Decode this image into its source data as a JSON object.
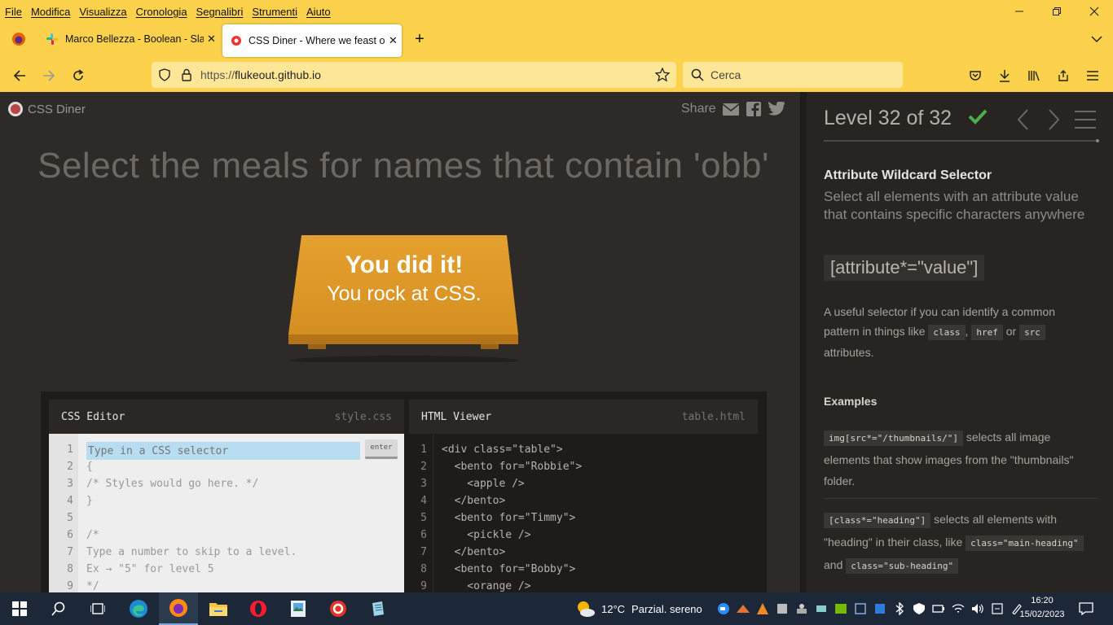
{
  "menu": [
    "File",
    "Modifica",
    "Visualizza",
    "Cronologia",
    "Segnalibri",
    "Strumenti",
    "Aiuto"
  ],
  "tabs": [
    {
      "label": "Marco Bellezza - Boolean - Slack"
    },
    {
      "label": "CSS Diner - Where we feast on CSS"
    }
  ],
  "url": {
    "prefix": "https://",
    "host": "flukeout.github.io"
  },
  "search": {
    "placeholder": "Cerca"
  },
  "site": {
    "brand": "CSS Diner",
    "share_label": "Share"
  },
  "instruction": "Select the meals for names that contain 'obb'",
  "table_message": {
    "line1": "You did it!",
    "line2": "You rock at CSS."
  },
  "css_editor": {
    "title": "CSS Editor",
    "file": "style.css",
    "placeholder": "Type in a CSS selector",
    "enter_label": "enter",
    "lines": [
      "{",
      "/* Styles would go here. */",
      "}",
      "",
      "/*",
      "Type a number to skip to a level.",
      "Ex → \"5\" for level 5",
      "*/"
    ],
    "line_numbers": [
      "1",
      "2",
      "3",
      "4",
      "5",
      "6",
      "7",
      "8",
      "9"
    ]
  },
  "html_viewer": {
    "title": "HTML Viewer",
    "file": "table.html",
    "lines": [
      "<div class=\"table\">",
      "  <bento for=\"Robbie\">",
      "    <apple />",
      "  </bento>",
      "  <bento for=\"Timmy\">",
      "    <pickle />",
      "  </bento>",
      "  <bento for=\"Bobby\">",
      "    <orange />"
    ],
    "line_numbers": [
      "1",
      "2",
      "3",
      "4",
      "5",
      "6",
      "7",
      "8",
      "9"
    ]
  },
  "level": {
    "label": "Level 32 of 32",
    "accent": "#4cae4c"
  },
  "selector": {
    "name": "Attribute Wildcard Selector",
    "title": "Select all elements with an attribute value that contains specific characters anywhere",
    "syntax": "[attribute*=\"value\"]",
    "hint_text1": "A useful selector if you can identify a common pattern in things like",
    "hint_code1": "class",
    "hint_sep": ",",
    "hint_code2": "href",
    "hint_or": "or",
    "hint_code3": "src",
    "hint_text2": "attributes."
  },
  "examples": {
    "title": "Examples",
    "ex1_code": "img[src*=\"/thumbnails/\"]",
    "ex1_text": "selects all image elements that show images from the \"thumbnails\" folder.",
    "ex2_code": "[class*=\"heading\"]",
    "ex2_text": "selects all elements with \"heading\" in their class, like",
    "ex2_code2": "class=\"main-heading\"",
    "ex2_and": "and",
    "ex2_code3": "class=\"sub-heading\""
  },
  "taskbar": {
    "weather_temp": "12°C",
    "weather_desc": "Parzial. sereno",
    "time": "16:20",
    "date": "15/02/2023"
  }
}
